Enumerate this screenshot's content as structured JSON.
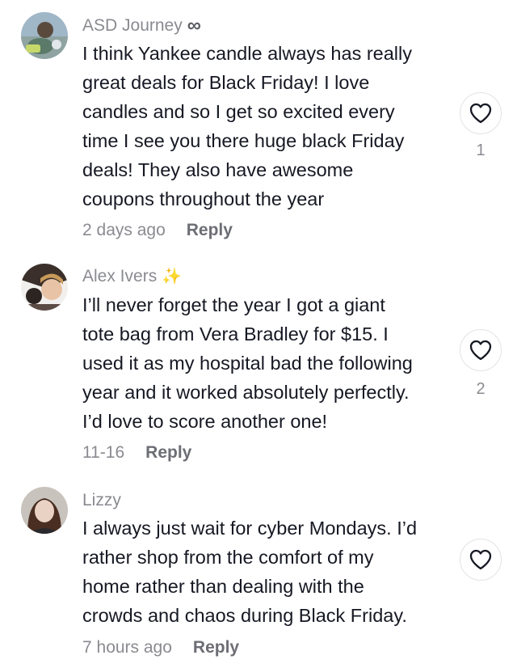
{
  "comments": [
    {
      "username": "ASD Journey",
      "badge": "∞",
      "lines": [
        "I think Yankee candle always has really",
        "great deals for Black Friday! I love",
        "candles and so I get so excited every",
        "time I see you there huge black Friday",
        "deals! They also have awesome",
        "coupons throughout the year"
      ],
      "time": "2 days ago",
      "reply_label": "Reply",
      "likes": "1",
      "avatar_icon": "avatar-photo"
    },
    {
      "username": "Alex Ivers",
      "badge": "✨",
      "lines": [
        "I’ll never forget the year I got a giant",
        "tote bag from Vera Bradley for $15. I",
        "used it as my hospital bad the following",
        "year and it worked absolutely perfectly.",
        "I’d love to score another one!"
      ],
      "time": "11-16",
      "reply_label": "Reply",
      "likes": "2",
      "avatar_icon": "avatar-photo"
    },
    {
      "username": "Lizzy",
      "badge": "",
      "lines": [
        "I always just wait for cyber Mondays. I’d",
        "rather shop from the comfort of my",
        "home rather than dealing with the",
        "crowds and chaos during Black Friday."
      ],
      "time": "7 hours ago",
      "reply_label": "Reply",
      "likes": "",
      "avatar_icon": "avatar-photo"
    }
  ],
  "icons": {
    "like": "heart-outline-icon",
    "badge_1": "infinity-icon",
    "badge_2": "sparkles-icon"
  },
  "colors": {
    "text": "#161823",
    "secondary": "#8a8b91",
    "reply": "#6d6e75"
  }
}
